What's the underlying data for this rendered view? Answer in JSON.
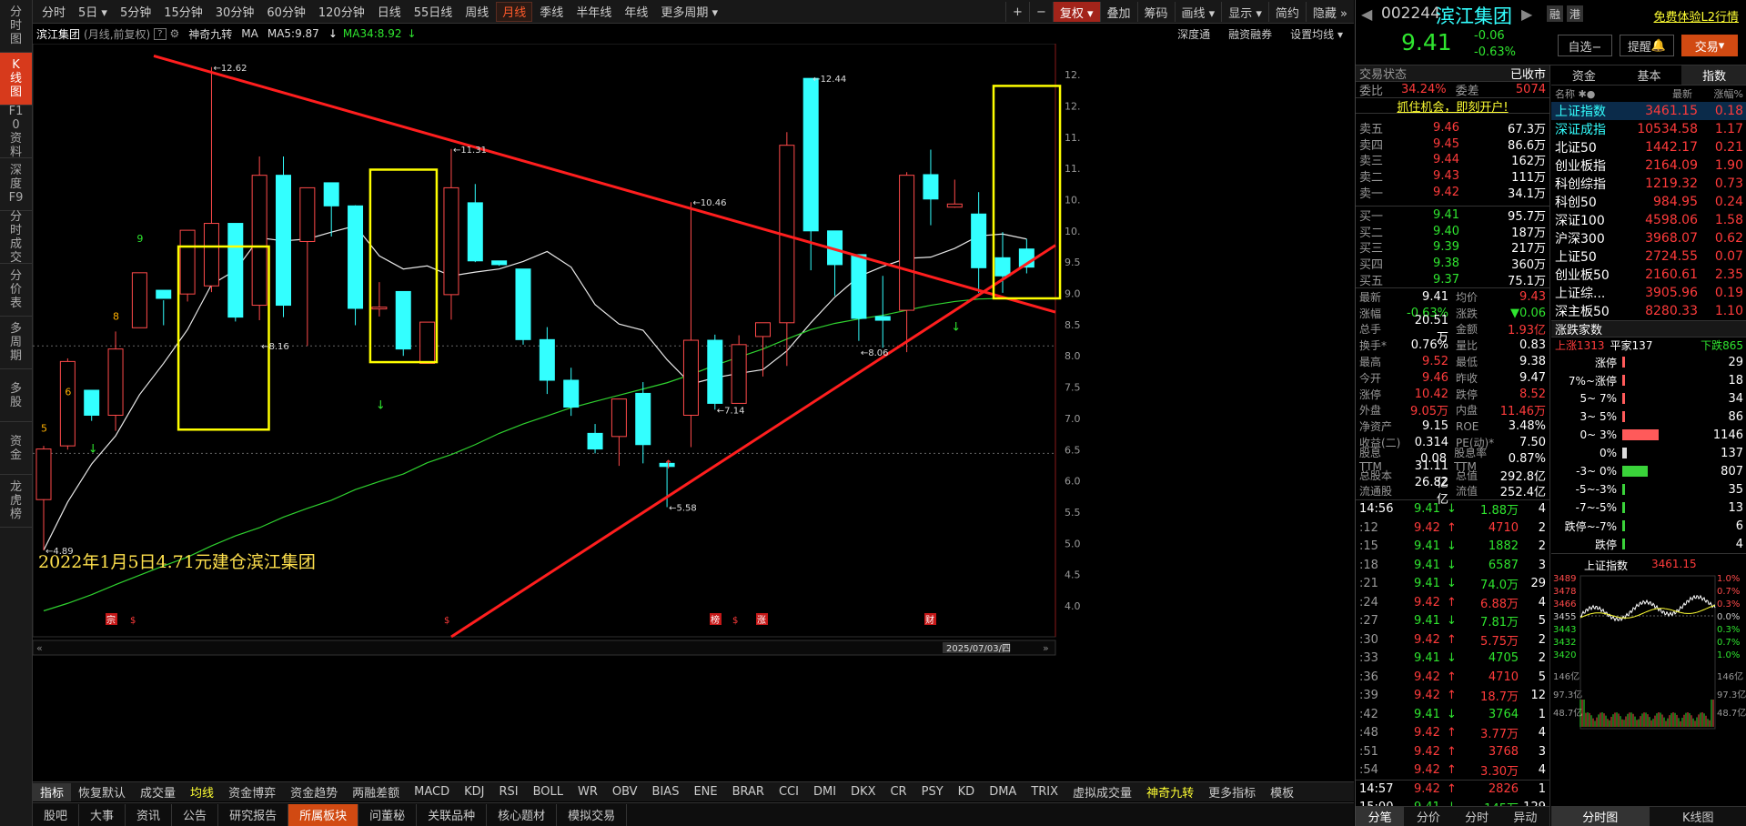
{
  "sidebar": [
    "分时图",
    "K线图",
    "F10资料",
    "深度F9",
    "分时成交",
    "分价表",
    "多周期",
    "多股",
    "资金",
    "龙虎榜"
  ],
  "toolbar": {
    "periods": [
      "分时",
      "5日",
      "5分钟",
      "15分钟",
      "30分钟",
      "60分钟",
      "120分钟",
      "日线",
      "55日线",
      "周线",
      "月线",
      "季线",
      "半年线",
      "年线",
      "更多周期"
    ],
    "active": "月线",
    "right": [
      "+",
      "−",
      "复权",
      "叠加",
      "筹码",
      "画线",
      "显示",
      "简约",
      "隐藏"
    ]
  },
  "info": {
    "stock": "滨江集团",
    "sub": "(月线,前复权)",
    "tool": "神奇九转",
    "ma": "MA",
    "ma5": "MA5:9.87",
    "ma34": "MA34:8.92",
    "right": [
      "深度通",
      "融资融券",
      "设置均线"
    ]
  },
  "chart_data": {
    "type": "candlestick",
    "period": "monthly",
    "ylim": [
      3.8,
      12.7
    ],
    "yticks": [
      4.0,
      4.5,
      5.0,
      5.5,
      6.0,
      6.5,
      7.0,
      7.5,
      8.0,
      8.5,
      9.0,
      9.5,
      10.0,
      10.5,
      11.0,
      11.5,
      12.0,
      12.5
    ],
    "candles": [
      [
        5.7,
        6.51,
        6.56,
        4.89
      ],
      [
        6.56,
        7.91,
        7.96,
        6.5
      ],
      [
        7.45,
        7.05,
        7.45,
        6.96
      ],
      [
        7.05,
        8.11,
        8.39,
        6.8
      ],
      [
        8.45,
        9.33,
        9.33,
        8.46
      ],
      [
        9.05,
        8.92,
        8.89,
        8.49
      ],
      [
        8.99,
        10.01,
        10.01,
        8.87
      ],
      [
        9.12,
        10.12,
        12.62,
        9.02
      ],
      [
        10.12,
        8.62,
        10.12,
        8.55
      ],
      [
        8.81,
        10.89,
        11.19,
        8.57
      ],
      [
        10.89,
        8.81,
        11.19,
        8.62
      ],
      [
        9.83,
        10.69,
        10.69,
        8.16
      ],
      [
        10.77,
        10.4,
        10.49,
        9.91
      ],
      [
        10.4,
        8.76,
        10.41,
        8.49
      ],
      [
        8.76,
        8.78,
        9.18,
        8.63
      ],
      [
        9.03,
        8.11,
        8.71,
        8.0
      ],
      [
        7.88,
        8.54,
        8.54,
        7.88
      ],
      [
        8.98,
        10.69,
        11.31,
        8.58
      ],
      [
        10.45,
        9.52,
        10.75,
        9.5
      ],
      [
        9.52,
        9.46,
        9.46,
        9.44
      ],
      [
        9.39,
        8.26,
        9.39,
        8.18
      ],
      [
        8.26,
        7.61,
        8.46,
        7.39
      ],
      [
        7.61,
        7.18,
        7.81,
        7.04
      ],
      [
        6.76,
        6.51,
        6.91,
        6.44
      ],
      [
        6.71,
        7.31,
        7.31,
        6.24
      ],
      [
        7.4,
        6.58,
        7.58,
        6.28
      ],
      [
        6.28,
        6.23,
        6.31,
        5.58
      ],
      [
        7.05,
        8.25,
        10.46,
        6.54
      ],
      [
        8.25,
        7.24,
        8.34,
        7.14
      ],
      [
        7.24,
        8.18,
        8.33,
        7.44
      ],
      [
        8.31,
        8.53,
        8.49,
        7.67
      ],
      [
        8.53,
        11.37,
        11.58,
        7.84
      ],
      [
        12.44,
        10.0,
        12.44,
        9.37
      ],
      [
        10.0,
        9.46,
        9.97,
        8.96
      ],
      [
        9.62,
        8.6,
        9.58,
        8.24
      ],
      [
        8.63,
        8.57,
        9.28,
        8.13
      ],
      [
        8.73,
        10.89,
        10.94,
        8.06
      ],
      [
        10.9,
        10.51,
        11.3,
        10.09
      ],
      [
        10.38,
        10.43,
        10.82,
        10.37
      ],
      [
        10.27,
        9.41,
        10.62,
        9.01
      ],
      [
        9.57,
        9.28,
        9.98,
        9.01
      ],
      [
        9.71,
        9.42,
        9.87,
        9.32
      ]
    ],
    "annotations": [
      "12.62",
      "11.31",
      "12.44",
      "10.46",
      "8.16",
      "8.06",
      "7.14",
      "5.58",
      "4.89"
    ],
    "td_counts": [
      "5",
      "6",
      "8",
      "9"
    ],
    "caption": "2022年1月5日4.71元建仓滨江集团",
    "markers": [
      "宗",
      "$",
      "$",
      "榜",
      "$",
      "涨",
      "财"
    ],
    "date_label": "2025/07/03/四",
    "ma_series": [
      {
        "name": "MA5",
        "values": [
          4.89,
          5.66,
          6.27,
          6.72,
          7.38,
          7.88,
          8.42,
          9.14,
          9.37,
          9.89,
          9.84,
          9.87,
          9.98,
          10.08,
          9.6,
          9.39,
          9.44,
          9.28,
          9.34,
          9.39,
          9.51,
          9.67,
          9.42,
          8.82,
          8.51,
          8.41,
          7.94,
          7.55,
          7.65,
          7.72,
          7.78,
          8.08,
          8.53,
          8.94,
          9.27,
          9.43,
          9.56,
          9.58,
          9.72,
          9.92,
          9.95,
          9.87
        ]
      },
      {
        "name": "MA34",
        "values": [
          3.92,
          4.04,
          4.18,
          4.34,
          4.49,
          4.64,
          4.78,
          4.96,
          5.12,
          5.25,
          5.42,
          5.56,
          5.69,
          5.86,
          5.99,
          6.11,
          6.29,
          6.42,
          6.58,
          6.76,
          6.91,
          7.04,
          7.17,
          7.27,
          7.37,
          7.47,
          7.57,
          7.7,
          7.85,
          7.98,
          8.11,
          8.27,
          8.42,
          8.52,
          8.59,
          8.65,
          8.73,
          8.81,
          8.87,
          8.91,
          8.92,
          8.92
        ]
      }
    ]
  },
  "bottabs": [
    "指标",
    "恢复默认",
    "成交量",
    "均线",
    "资金博弈",
    "资金趋势",
    "两融差额",
    "MACD",
    "KDJ",
    "RSI",
    "BOLL",
    "WR",
    "OBV",
    "BIAS",
    "ENE",
    "BRAR",
    "CCI",
    "DMI",
    "DKX",
    "CR",
    "PSY",
    "KD",
    "DMA",
    "TRIX",
    "虚拟成交量",
    "神奇九转",
    "更多指标",
    "模板"
  ],
  "botnav": [
    "股吧",
    "大事",
    "资讯",
    "公告",
    "研究报告",
    "所属板块",
    "问董秘",
    "关联品种",
    "核心题材",
    "模拟交易"
  ],
  "botnav_active": "所属板块",
  "quote": {
    "code": "002244",
    "name": "滨江集团",
    "price": "9.41",
    "chg": "-0.06",
    "pct": "-0.63%",
    "btns": [
      "融",
      "港"
    ],
    "trial": "免费体验L2行情",
    "selfbtn": "自选−",
    "remind": "提醒",
    "trade": "交易",
    "status": "交易状态",
    "status_v": "已收市",
    "wb": "34.24%",
    "wc": "5074",
    "promo": "抓住机会，即刻开户!",
    "asks": [
      [
        "卖五",
        "9.46",
        "67.3万"
      ],
      [
        "卖四",
        "9.45",
        "86.6万"
      ],
      [
        "卖三",
        "9.44",
        "162万"
      ],
      [
        "卖二",
        "9.43",
        "111万"
      ],
      [
        "卖一",
        "9.42",
        "34.1万"
      ]
    ],
    "bids": [
      [
        "买一",
        "9.41",
        "95.7万"
      ],
      [
        "买二",
        "9.40",
        "187万"
      ],
      [
        "买三",
        "9.39",
        "217万"
      ],
      [
        "买四",
        "9.38",
        "360万"
      ],
      [
        "买五",
        "9.37",
        "75.1万"
      ]
    ],
    "stats": [
      [
        "最新",
        "9.41",
        "均价",
        "9.43"
      ],
      [
        "涨幅",
        "-0.63%",
        "涨跌",
        "▼0.06"
      ],
      [
        "总手",
        "20.51万",
        "金额",
        "1.93亿"
      ],
      [
        "换手*",
        "0.76%",
        "量比",
        "0.83"
      ],
      [
        "最高",
        "9.52",
        "最低",
        "9.38"
      ],
      [
        "今开",
        "9.46",
        "昨收",
        "9.47"
      ],
      [
        "涨停",
        "10.42",
        "跌停",
        "8.52"
      ],
      [
        "外盘",
        "9.05万",
        "内盘",
        "11.46万"
      ],
      [
        "净资产",
        "9.15",
        "ROE",
        "3.48%"
      ],
      [
        "收益(二)",
        "0.314",
        "PE(动)*",
        "7.50"
      ],
      [
        "股息TTM",
        "0.08",
        "股息率TTM",
        "0.87%"
      ],
      [
        "总股本",
        "31.11亿",
        "总值",
        "292.8亿"
      ],
      [
        "流通股",
        "26.82亿",
        "流值",
        "252.4亿"
      ]
    ],
    "ticks": [
      [
        "14:56",
        "9.41",
        "1.88万",
        "4"
      ],
      [
        ":12",
        "9.42",
        "4710",
        "2"
      ],
      [
        ":15",
        "9.41",
        "1882",
        "2"
      ],
      [
        ":18",
        "9.41",
        "6587",
        "3"
      ],
      [
        ":21",
        "9.41",
        "74.0万",
        "29"
      ],
      [
        ":24",
        "9.42",
        "6.88万",
        "4"
      ],
      [
        ":27",
        "9.41",
        "7.81万",
        "5"
      ],
      [
        ":30",
        "9.42",
        "5.75万",
        "2"
      ],
      [
        ":33",
        "9.41",
        "4705",
        "2"
      ],
      [
        ":36",
        "9.42",
        "4710",
        "5"
      ],
      [
        ":39",
        "9.42",
        "18.7万",
        "12"
      ],
      [
        ":42",
        "9.41",
        "3764",
        "1"
      ],
      [
        ":48",
        "9.42",
        "3.77万",
        "4"
      ],
      [
        ":51",
        "9.42",
        "3768",
        "3"
      ],
      [
        ":54",
        "9.42",
        "3.30万",
        "4"
      ],
      [
        "14:57",
        "9.42",
        "2826",
        "1"
      ],
      [
        "15:00",
        "9.41",
        "145万",
        "129"
      ]
    ],
    "ltabs": [
      "分笔",
      "分价",
      "分时",
      "异动"
    ]
  },
  "indices": {
    "tabs": [
      "资金",
      "基本",
      "指数"
    ],
    "head": [
      "名称",
      "最新",
      "涨幅%"
    ],
    "rows": [
      [
        "上证指数",
        "3461.15",
        "0.18"
      ],
      [
        "深证成指",
        "10534.58",
        "1.17"
      ],
      [
        "北证50",
        "1442.17",
        "0.21"
      ],
      [
        "创业板指",
        "2164.09",
        "1.90"
      ],
      [
        "科创综指",
        "1219.32",
        "0.73"
      ],
      [
        "科创50",
        "984.95",
        "0.24"
      ],
      [
        "深证100",
        "4598.06",
        "1.58"
      ],
      [
        "沪深300",
        "3968.07",
        "0.62"
      ],
      [
        "上证50",
        "2724.55",
        "0.07"
      ],
      [
        "创业板50",
        "2160.61",
        "2.35"
      ],
      [
        "上证综...",
        "3905.96",
        "0.19"
      ],
      [
        "深主板50",
        "8280.33",
        "1.10"
      ]
    ],
    "dist_title": "涨跌家数",
    "up": "上涨1313",
    "flat": "平家137",
    "down": "下跌865",
    "dist": [
      [
        "涨停",
        "29"
      ],
      [
        "7%~涨停",
        "18"
      ],
      [
        "5~ 7%",
        "34"
      ],
      [
        "3~ 5%",
        "86"
      ],
      [
        "0~ 3%",
        "1146"
      ],
      [
        "0%",
        "137"
      ],
      [
        "-3~ 0%",
        "807"
      ],
      [
        "-5~-3%",
        "35"
      ],
      [
        "-7~-5%",
        "13"
      ],
      [
        "跌停~-7%",
        "6"
      ],
      [
        "跌停",
        "4"
      ]
    ],
    "mini_title": "上证指数",
    "mini_val": "3461.15",
    "mini_left": [
      "3489",
      "3478",
      "3466",
      "3455",
      "3443",
      "3432",
      "3420",
      "146亿",
      "97.3亿",
      "48.7亿"
    ],
    "mini_right": [
      "1.0%",
      "0.7%",
      "0.3%",
      "0.0%",
      "0.3%",
      "0.7%",
      "1.0%",
      "146亿",
      "97.3亿",
      "48.7亿"
    ],
    "rtabs": [
      "分时图",
      "K线图"
    ]
  }
}
